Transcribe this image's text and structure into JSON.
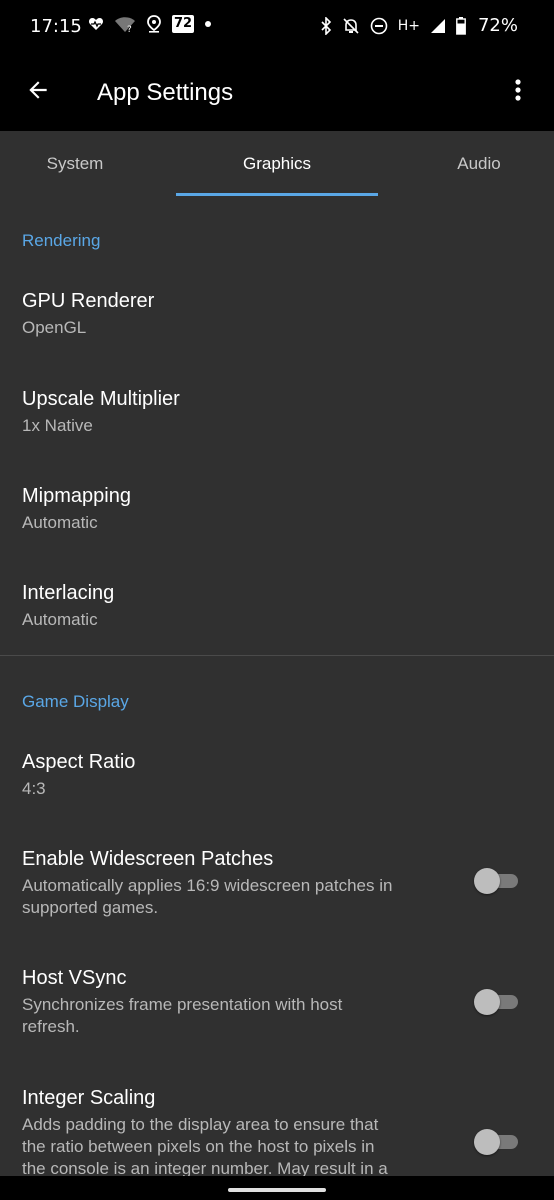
{
  "status_bar": {
    "time": "17:15",
    "badge": "72",
    "network": "H+",
    "battery": "72%",
    "left_icons": [
      "heart-monitor-icon",
      "wifi-question-icon",
      "location-icon",
      "badge-72-icon",
      "dot-icon"
    ],
    "right_icons": [
      "bluetooth-icon",
      "bell-off-icon",
      "do-not-disturb-icon",
      "signal-icon",
      "battery-icon"
    ]
  },
  "app_bar": {
    "title": "App Settings",
    "back_icon": "arrow-left-icon",
    "menu_icon": "more-vert-icon"
  },
  "tabs": [
    {
      "label": "System",
      "active": false
    },
    {
      "label": "Graphics",
      "active": true
    },
    {
      "label": "Audio",
      "active": false
    }
  ],
  "sections": {
    "rendering": {
      "header": "Rendering",
      "items": [
        {
          "title": "GPU Renderer",
          "summary": "OpenGL"
        },
        {
          "title": "Upscale Multiplier",
          "summary": "1x Native"
        },
        {
          "title": "Mipmapping",
          "summary": "Automatic"
        },
        {
          "title": "Interlacing",
          "summary": "Automatic"
        }
      ]
    },
    "game_display": {
      "header": "Game Display",
      "items": [
        {
          "title": "Aspect Ratio",
          "summary": "4:3"
        },
        {
          "title": "Enable Widescreen Patches",
          "summary_lines": [
            "Automatically applies 16:9 widescreen patches in",
            "supported games."
          ],
          "switch_on": false
        },
        {
          "title": "Host VSync",
          "summary_lines": [
            "Synchronizes frame presentation with host",
            "refresh."
          ],
          "switch_on": false
        },
        {
          "title": "Integer Scaling",
          "summary_lines": [
            "Adds padding to the display area to ensure that",
            "the ratio between pixels on the host to pixels in",
            "the console is an integer number. May result in a"
          ],
          "switch_on": false
        }
      ]
    }
  },
  "colors": {
    "accent": "#5aa7e6",
    "background": "#303030",
    "bar": "#000000"
  }
}
